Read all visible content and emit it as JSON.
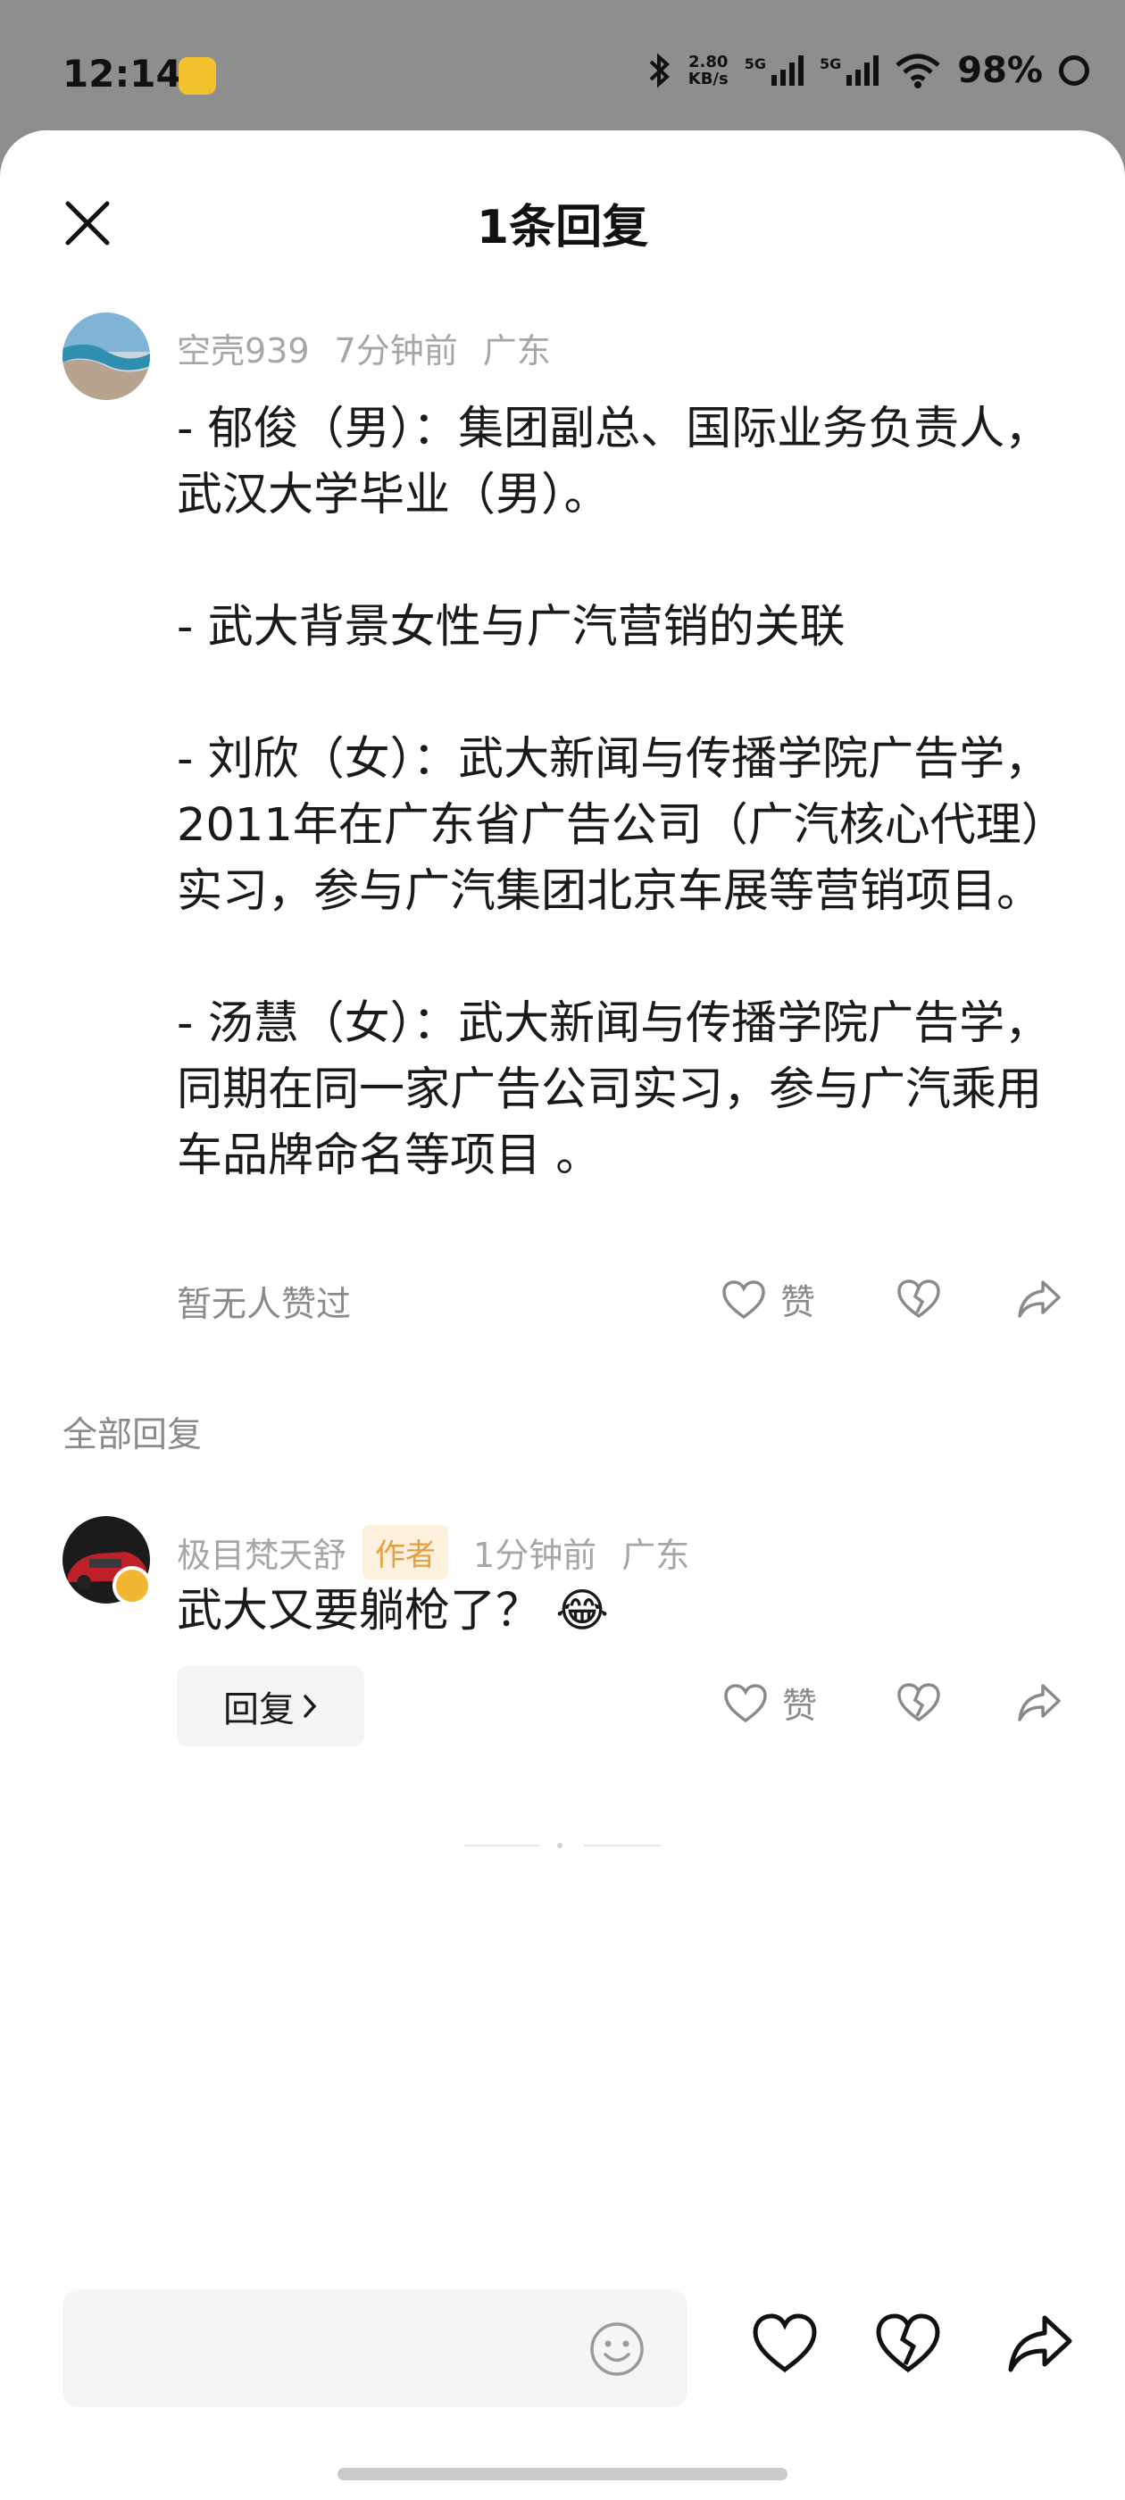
{
  "status_bar": {
    "time": "12:14",
    "net_speed": "2.80",
    "net_unit": "KB/s",
    "sim1": "5G",
    "sim2": "5G",
    "battery": "98%"
  },
  "sheet": {
    "title": "1条回复"
  },
  "main_comment": {
    "username": "空壳939",
    "time_ago": "7分钟前",
    "location": "广东",
    "paragraphs": [
      "- 郁俊（男）：集团副总、国际业务负责人，武汉大学毕业（男）。",
      "- 武大背景女性与广汽营销的关联",
      "- 刘欣（女）：武大新闻与传播学院广告学，2011年在广东省广告公司（广汽核心代理）实习，参与广汽集团北京车展等营销项目。",
      "- 汤慧（女）：武大新闻与传播学院广告学，同期在同一家广告公司实习，参与广汽乘用车品牌命名等项目 。"
    ],
    "no_likes": "暂无人赞过",
    "like_label": "赞"
  },
  "replies_section": {
    "label": "全部回复"
  },
  "reply": {
    "username": "极目梵天舒",
    "badge": "作者",
    "time_ago": "1分钟前",
    "location": "广东",
    "text": "武大又要躺枪了？",
    "emoji": "😂",
    "reply_button": "回复",
    "like_label": "赞"
  },
  "colors": {
    "overlay": "#8e8e8e",
    "sheet": "#ffffff",
    "meta_text": "#a6a6a6",
    "badge_bg": "#fdf0dc",
    "badge_text": "#e2a042"
  }
}
